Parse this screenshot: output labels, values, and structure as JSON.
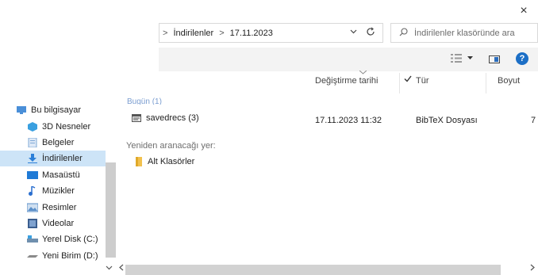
{
  "window": {
    "close_glyph": "×"
  },
  "address": {
    "segments": [
      "İndirilenler",
      "17.11.2023"
    ],
    "separator": ">"
  },
  "search": {
    "placeholder": "İndirilenler klasöründe ara"
  },
  "columns": {
    "modified": "Değiştirme tarihi",
    "type": "Tür",
    "size": "Boyut"
  },
  "nav": {
    "items": [
      {
        "label": "Bu bilgisayar",
        "icon": "computer-icon",
        "color": "#4a8fd8",
        "selected": false
      },
      {
        "label": "3D Nesneler",
        "icon": "3d-objects-icon",
        "color": "#3aa0e0",
        "selected": false
      },
      {
        "label": "Belgeler",
        "icon": "documents-icon",
        "color": "#7fa9d6",
        "selected": false
      },
      {
        "label": "İndirilenler",
        "icon": "downloads-icon",
        "color": "#2b7fd8",
        "selected": true
      },
      {
        "label": "Masaüstü",
        "icon": "desktop-icon",
        "color": "#1f7ad6",
        "selected": false
      },
      {
        "label": "Müzikler",
        "icon": "music-icon",
        "color": "#2b6fcf",
        "selected": false
      },
      {
        "label": "Resimler",
        "icon": "pictures-icon",
        "color": "#5b8fc9",
        "selected": false
      },
      {
        "label": "Videolar",
        "icon": "videos-icon",
        "color": "#3b5e8f",
        "selected": false
      },
      {
        "label": "Yerel Disk (C:)",
        "icon": "local-disk-icon",
        "color": "#6f8fae",
        "selected": false
      },
      {
        "label": "Yeni Birim (D:)",
        "icon": "drive-icon",
        "color": "#8a8a8a",
        "selected": false
      }
    ]
  },
  "group_partial_label": "Bugün (1)",
  "files": [
    {
      "name": "savedrecs (3)",
      "modified": "17.11.2023 11:32",
      "type": "BibTeX Dosyası",
      "size": "7",
      "icon": "text-file-icon"
    }
  ],
  "search_again": {
    "label": "Yeniden aranacağı yer:",
    "items": [
      {
        "label": "Alt Klasörler",
        "icon": "folder-icon",
        "color": "#f2c14e"
      }
    ]
  }
}
